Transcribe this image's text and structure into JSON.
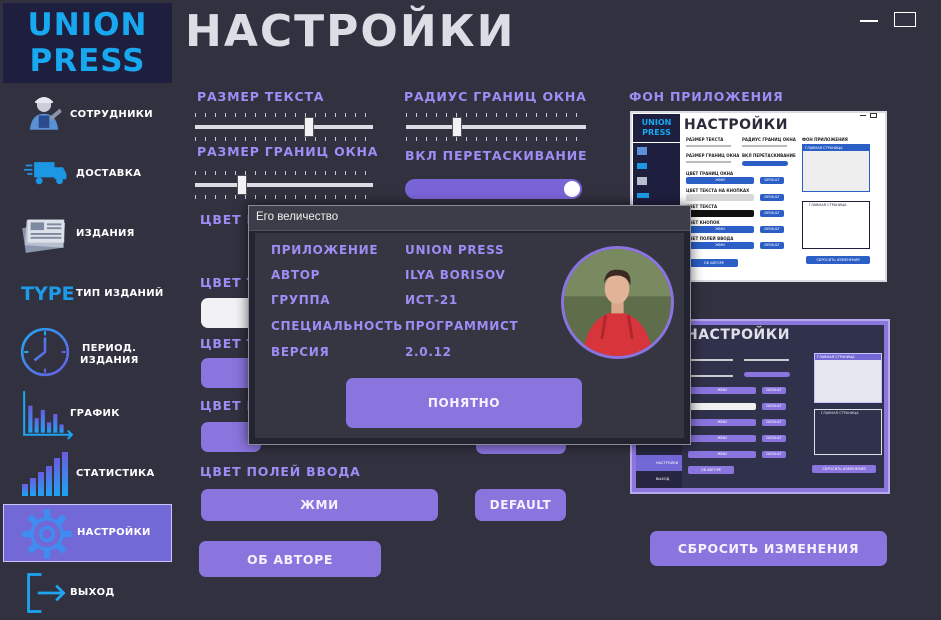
{
  "app": {
    "logo_line1": "UNION",
    "logo_line2": "PRESS",
    "title": "НАСТРОЙКИ"
  },
  "sidebar": {
    "items": [
      {
        "label": "СОТРУДНИКИ",
        "icon": "worker-icon"
      },
      {
        "label": "ДОСТАВКА",
        "icon": "truck-icon"
      },
      {
        "label": "ИЗДАНИЯ",
        "icon": "newspaper-icon"
      },
      {
        "label": "ТИП ИЗДАНИЙ",
        "icon": "type-icon",
        "icon_text": "TYPE"
      },
      {
        "label_1": "ПЕРИОД.",
        "label_2": "ИЗДАНИЯ",
        "icon": "clock-icon"
      },
      {
        "label": "ГРАФИК",
        "icon": "bar-chart-icon"
      },
      {
        "label": "СТАТИСТИКА",
        "icon": "statistics-icon"
      },
      {
        "label": "НАСТРОЙКИ",
        "icon": "gear-icon",
        "active": true
      },
      {
        "label": "ВЫХОД",
        "icon": "exit-icon"
      }
    ]
  },
  "settings": {
    "text_size_label": "РАЗМЕР ТЕКСТА",
    "border_size_label": "РАЗМЕР ГРАНИЦ ОКНА",
    "radius_label": "РАДИУС ГРАНИЦ ОКНА",
    "drag_label": "ВКЛ ПЕРЕТАСКИВАНИЕ",
    "bg_label": "ФОН ПРИЛОЖЕНИЯ",
    "color_labels_partial": [
      "ЦВЕТ Г",
      "ЦВЕТ Т",
      "ЦВЕТ Т",
      "ЦВЕТ К"
    ],
    "input_color_label": "ЦВЕТ ПОЛЕЙ ВВОДА",
    "input_color_button": "ЖМИ",
    "default_button": "DEFAULT",
    "about_button": "ОБ АВТОРЕ",
    "reset_button": "СБРОСИТЬ ИЗМЕНЕНИЯ"
  },
  "sliders": {
    "text_size": 0.65,
    "border_size": 0.25,
    "radius": 0.27
  },
  "drag_enabled": true,
  "modal": {
    "title": "Его величество",
    "rows": [
      {
        "key": "ПРИЛОЖЕНИЕ",
        "value": "UNION PRESS"
      },
      {
        "key": "АВТОР",
        "value": "ILYA BORISOV"
      },
      {
        "key": "ГРУППА",
        "value": "ИСТ-21"
      },
      {
        "key": "СПЕЦИАЛЬНОСТЬ",
        "value": "ПРОГРАММИСТ"
      },
      {
        "key": "ВЕРСИЯ",
        "value": "2.0.12"
      }
    ],
    "ok_button": "ПОНЯТНО"
  },
  "preview_light": {
    "logo_1": "UNION",
    "logo_2": "PRESS",
    "title": "НАСТРОЙКИ",
    "labels": [
      "РАЗМЕР ТЕКСТА",
      "РАДИУС ГРАНИЦ ОКНА",
      "ФОН ПРИЛОЖЕНИЯ",
      "РАЗМЕР ГРАНИЦ ОКНА",
      "ВКЛ ПЕРЕТАСКИВАНИЕ",
      "ЦВЕТ ГРАНИЦ ОКНА",
      "ЦВЕТ ТЕКСТА НА КНОПКАХ",
      "ЦВЕТ ТЕКСТА",
      "ЦВЕТ КНОПОК",
      "ЦВЕТ ПОЛЕЙ ВВОДА"
    ],
    "btn": "ЖМИ",
    "default": "DEFAULT",
    "about": "ОБ АВТОРЕ",
    "reset": "СБРОСИТЬ ИЗМЕНЕНИЯ",
    "panel_title": "ГЛАВНАЯ СТРАНИЦА"
  },
  "preview_dark": {
    "title": "НАСТРОЙКИ",
    "exit": "ВЫХОД",
    "settings": "НАСТРОЙКИ",
    "btn": "ЖМИ",
    "default": "DEFAULT",
    "about": "ОБ АВТОРЕ",
    "reset": "СБРОСИТЬ ИЗМЕНЕНИЯ",
    "panel_title": "ГЛАВНАЯ СТРАНИЦА"
  },
  "colors": {
    "accent": "#8a74de",
    "label": "#9d8df5",
    "background": "#31313f",
    "logo": "#18a8f0"
  }
}
